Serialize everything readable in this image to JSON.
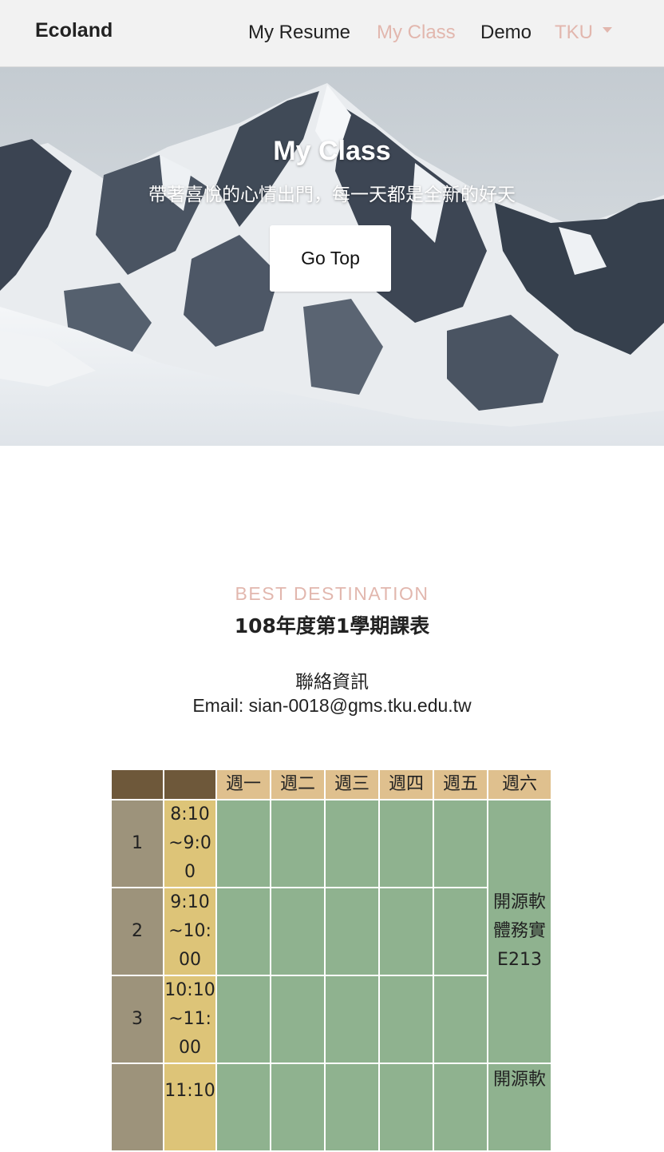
{
  "nav": {
    "brand": "Ecoland",
    "links": [
      "My Resume",
      "My Class",
      "Demo",
      "TKU"
    ]
  },
  "hero": {
    "title": "My Class",
    "subtitle": "帶著喜悅的心情出門，每一天都是全新的好天",
    "button": "Go Top"
  },
  "section": {
    "eyebrow": "BEST DESTINATION",
    "title": "108年度第1學期課表",
    "contact_title": "聯絡資訊",
    "contact_email": "Email: sian-0018@gms.tku.edu.tw"
  },
  "schedule": {
    "days": [
      "週一",
      "週二",
      "週三",
      "週四",
      "週五",
      "週六"
    ],
    "periods": [
      {
        "no": "1",
        "time": "8:10~9:00"
      },
      {
        "no": "2",
        "time": "9:10~10:00"
      },
      {
        "no": "3",
        "time": "10:10~11:00"
      },
      {
        "no": "",
        "time": "11:10"
      }
    ],
    "courses": [
      "開源軟體務實E213",
      "開源軟"
    ]
  },
  "colors": {
    "accent": "#e2b7ae",
    "table_header_dark": "#6e583a",
    "table_header_day": "#dfc08e",
    "table_period": "#9d937b",
    "table_time": "#ddc478",
    "table_cell": "#8fb28f"
  }
}
